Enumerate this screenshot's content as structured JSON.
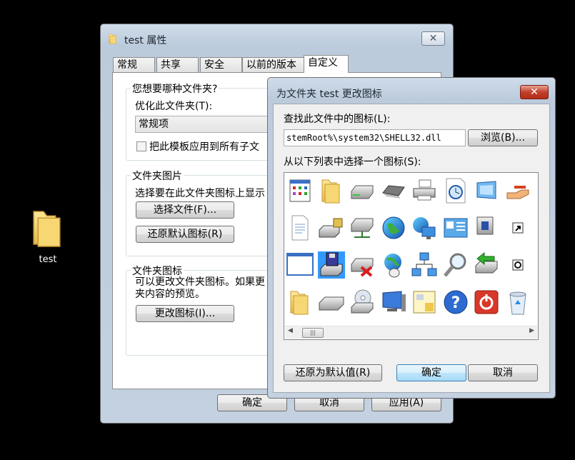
{
  "desktop": {
    "icon_label": "test"
  },
  "properties": {
    "title": "test 属性",
    "tabs": [
      "常规",
      "共享",
      "安全",
      "以前的版本",
      "自定义"
    ],
    "active_tab": "自定义",
    "folder_type": {
      "group_title": "您想要哪种文件夹?",
      "optimize_label": "优化此文件夹(T):",
      "selected_value": "常规项",
      "apply_template_label": "把此模板应用到所有子文"
    },
    "folder_picture": {
      "group_title": "文件夹图片",
      "description": "选择要在此文件夹图标上显示",
      "choose_file": "选择文件(F)...",
      "restore_default": "还原默认图标(R)"
    },
    "folder_icon": {
      "group_title": "文件夹图标",
      "description_line1": "可以更改文件夹图标。如果更",
      "description_line2": "夹内容的预览。",
      "change_icon": "更改图标(I)..."
    },
    "buttons": {
      "ok": "确定",
      "cancel": "取消",
      "apply": "应用(A)"
    }
  },
  "change_icon": {
    "title": "为文件夹 test 更改图标",
    "find_label": "查找此文件中的图标(L):",
    "path_value": "stemRoot%\\system32\\SHELL32.dll",
    "browse": "浏览(B)...",
    "select_label": "从以下列表中选择一个图标(S):",
    "restore_defaults": "还原为默认值(R)",
    "ok": "确定",
    "cancel": "取消",
    "selected_icon": "floppy-drive-icon",
    "icons": [
      [
        "application-window-icon",
        "folder-icon",
        "hard-drive-icon",
        "memory-chip-icon",
        "printer-icon",
        "clock-document-icon",
        "display-icon",
        "sharing-hand-icon"
      ],
      [
        "document-icon",
        "drive-lock-icon",
        "network-drive-icon",
        "globe-icon",
        "network-computer-icon",
        "control-panel-icon",
        "shortcut-drive-icon",
        "shortcut-arrow-icon"
      ],
      [
        "blank-window-icon",
        "floppy-drive-icon",
        "disconnected-drive-icon",
        "globe-mouse-icon",
        "network-icon",
        "search-icon",
        "green-arrow-icon",
        "clock-overlay-icon"
      ],
      [
        "folder-icon",
        "disk-drive-icon",
        "cd-drive-icon",
        "computer-icon",
        "notepad-icon",
        "help-icon",
        "shutdown-icon",
        "recycle-bin-icon"
      ]
    ]
  }
}
